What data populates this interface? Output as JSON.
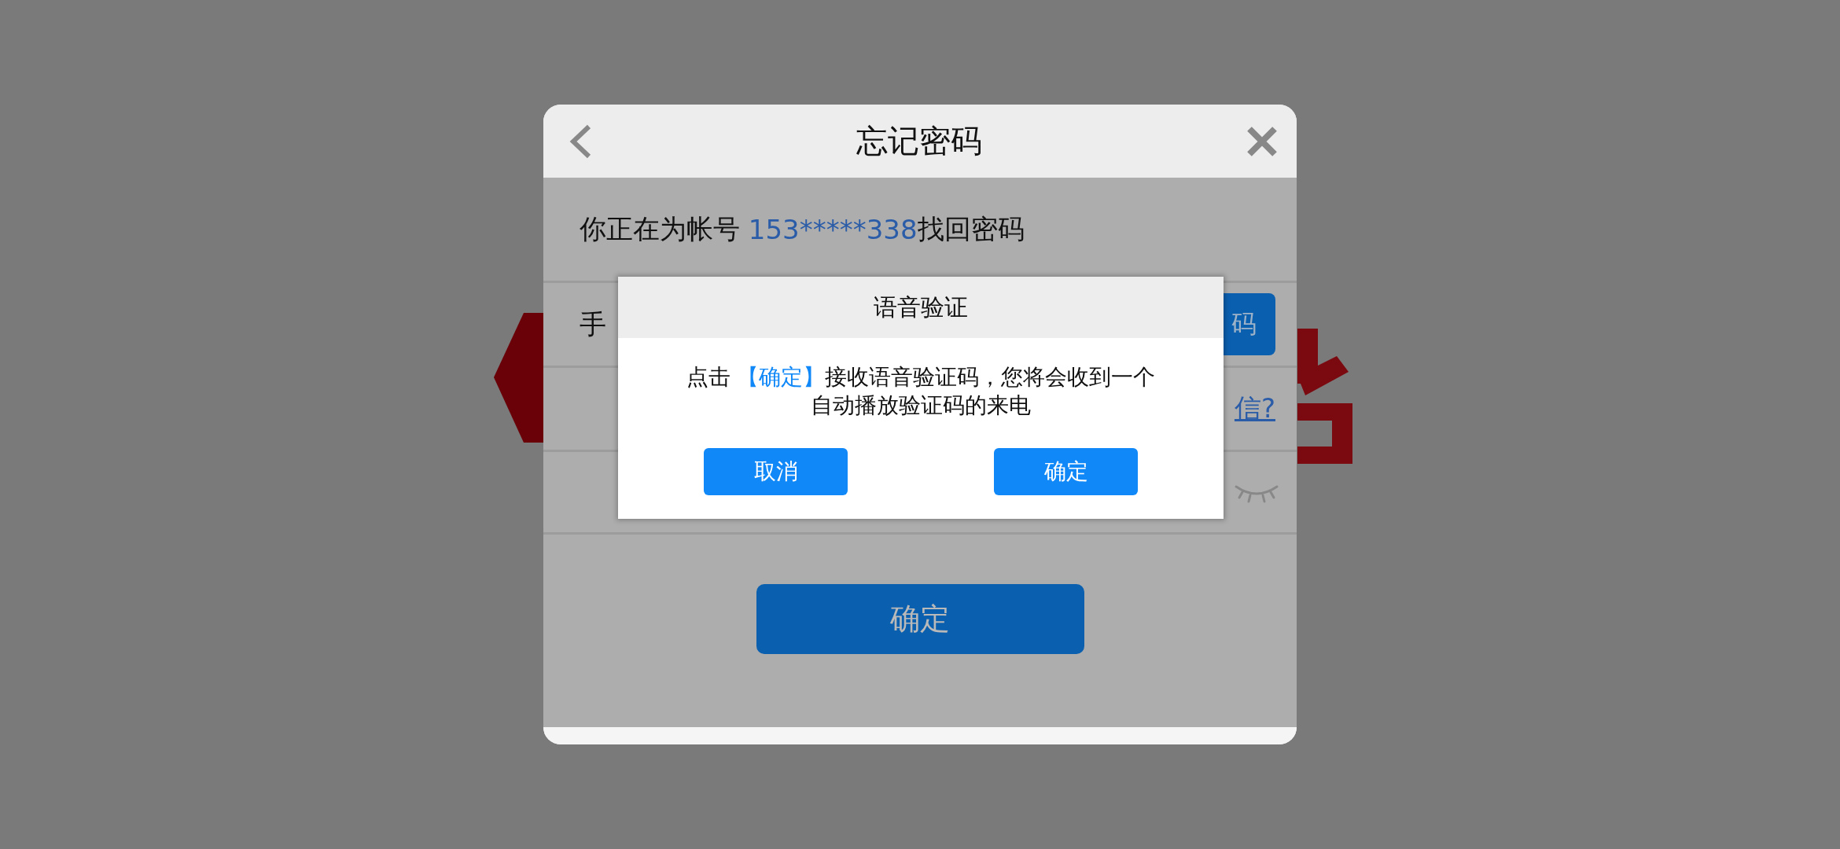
{
  "dialog": {
    "title": "忘记密码",
    "account_prompt": "你正在为帐号 ",
    "account_number": "153*****338",
    "account_suffix": "找回密码",
    "phone_label": "手",
    "code_button": "码",
    "sms_link": "信?",
    "password_visible": false,
    "confirm_button": "确定"
  },
  "voice_dialog": {
    "title": "语音验证",
    "message_prefix": "点击 ",
    "message_link": "【确定】",
    "message_text": "接收语音验证码，您将会收到一个自动播放验证码的来电",
    "buttons": [
      {
        "label": "取消"
      },
      {
        "label": "确定"
      }
    ]
  }
}
